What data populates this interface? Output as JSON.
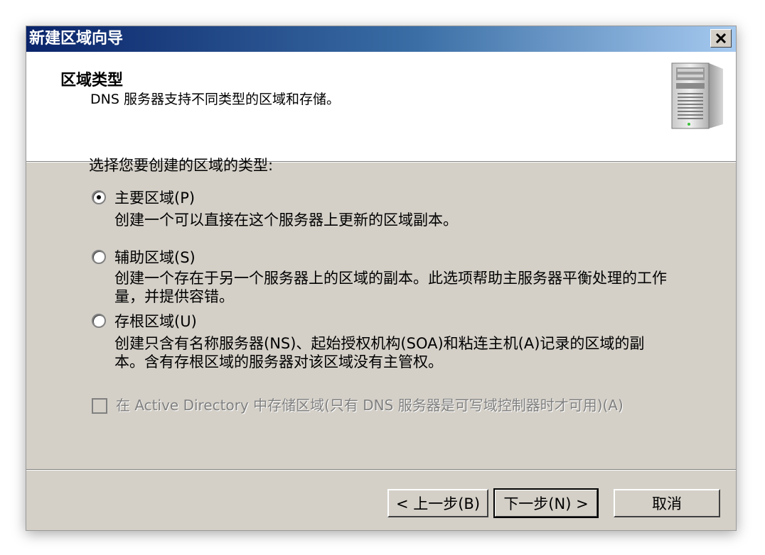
{
  "window": {
    "title": "新建区域向导"
  },
  "header": {
    "title": "区域类型",
    "subtitle": "DNS 服务器支持不同类型的区域和存储。",
    "icon": "server-tower-icon"
  },
  "prompt": "选择您要创建的区域的类型:",
  "zone_types": [
    {
      "label": "主要区域(P)",
      "selected": true,
      "description": "创建一个可以直接在这个服务器上更新的区域副本。"
    },
    {
      "label": "辅助区域(S)",
      "selected": false,
      "description": "创建一个存在于另一个服务器上的区域的副本。此选项帮助主服务器平衡处理的工作量，并提供容错。"
    },
    {
      "label": "存根区域(U)",
      "selected": false,
      "description": "创建只含有名称服务器(NS)、起始授权机构(SOA)和粘连主机(A)记录的区域的副本。含有存根区域的服务器对该区域没有主管权。"
    }
  ],
  "store_in_ad": {
    "label": "在 Active Directory 中存储区域(只有 DNS 服务器是可写域控制器时才可用)(A)",
    "checked": false,
    "enabled": false
  },
  "buttons": {
    "back": "< 上一步(B)",
    "next": "下一步(N) >",
    "cancel": "取消"
  }
}
